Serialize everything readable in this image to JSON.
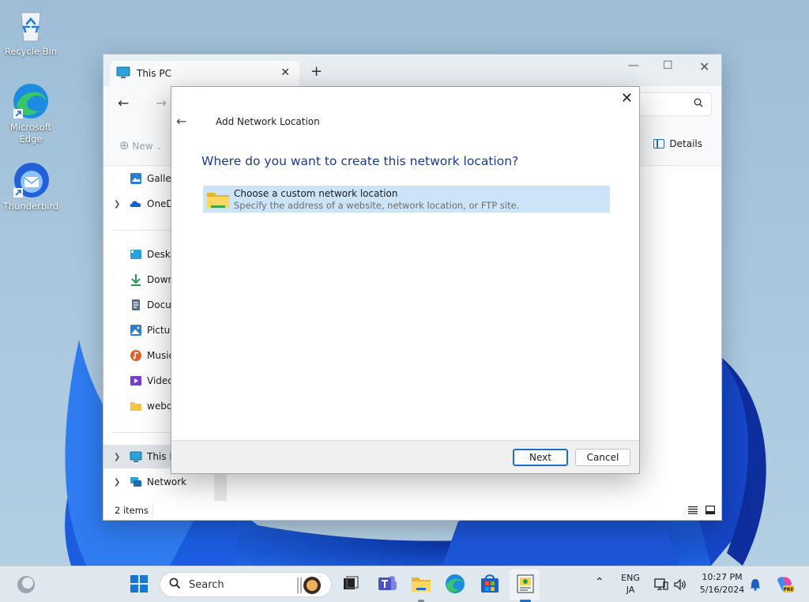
{
  "desktop": {
    "icons": [
      {
        "label": "Recycle Bin"
      },
      {
        "label": "Microsoft Edge"
      },
      {
        "label": "Thunderbird"
      }
    ]
  },
  "explorer": {
    "tab_title": "This PC",
    "new_label": "New",
    "details_label": "Details",
    "sidebar": [
      {
        "label": "Galler",
        "icon": "gallery-icon"
      },
      {
        "label": "OneD",
        "icon": "onedrive-icon"
      },
      {
        "label": "Deskto",
        "icon": "desktop-icon"
      },
      {
        "label": "Down",
        "icon": "download-icon"
      },
      {
        "label": "Docu",
        "icon": "document-icon"
      },
      {
        "label": "Pictur",
        "icon": "pictures-icon"
      },
      {
        "label": "Music",
        "icon": "music-icon"
      },
      {
        "label": "Video",
        "icon": "video-icon"
      },
      {
        "label": "webda",
        "icon": "folder-icon"
      },
      {
        "label": "This P",
        "icon": "this-pc-icon"
      },
      {
        "label": "Network",
        "icon": "network-icon"
      }
    ],
    "status": "2 items"
  },
  "dialog": {
    "title": "Add Network Location",
    "heading": "Where do you want to create this network location?",
    "option_title": "Choose a custom network location",
    "option_desc": "Specify the address of a website, network location, or FTP site.",
    "next_label": "Next",
    "cancel_label": "Cancel"
  },
  "taskbar": {
    "search_label": "Search",
    "lang_top": "ENG",
    "lang_bottom": "JA",
    "time": "10:27 PM",
    "date": "5/16/2024"
  },
  "colors": {
    "accent": "#1a6fc7",
    "heading": "#1a3a8f",
    "selection": "#cce4f7"
  }
}
